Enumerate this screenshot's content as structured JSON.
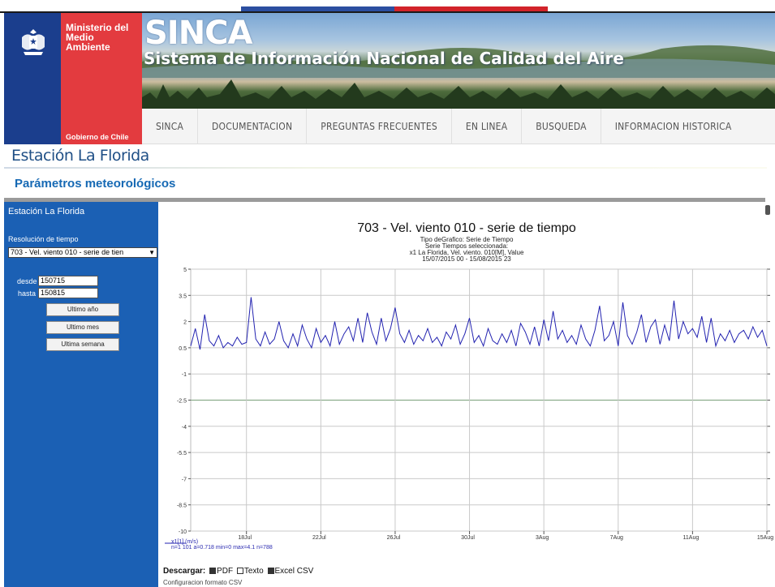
{
  "header": {
    "ministry_name": "Ministerio del Medio Ambiente",
    "gobierno": "Gobierno de Chile",
    "app_name": "SINCA",
    "app_subtitle": "Sistema de Información Nacional de Calidad del Aire",
    "colors": {
      "gov_blue": "#1b3e8d",
      "gov_red": "#e33b3f",
      "link_blue": "#1669b4"
    }
  },
  "nav": {
    "items": [
      {
        "label": "SINCA"
      },
      {
        "label": "DOCUMENTACION"
      },
      {
        "label": "PREGUNTAS FRECUENTES"
      },
      {
        "label": "EN LINEA"
      },
      {
        "label": "BUSQUEDA"
      },
      {
        "label": "INFORMACION HISTORICA"
      }
    ]
  },
  "page": {
    "station_title": "Estación La Florida",
    "section_title": "Parámetros meteorológicos"
  },
  "panel": {
    "title": "Estación La Florida",
    "resolution_label": "Resolución de tiempo",
    "selected_series": "703 - Vel. viento 010 - serie de tien",
    "desde_label": "desde",
    "desde_value": "150715",
    "hasta_label": "hasta",
    "hasta_value": "150815",
    "btn_year": "Ultimo año",
    "btn_month": "Ultimo mes",
    "btn_week": "Ultima semana"
  },
  "chart_data": {
    "type": "line",
    "title": "703 - Vel. viento 010 - serie de tiempo",
    "subtitle_lines": [
      "Tipo deGrafico: Serie de Tiempo",
      "Serie Tiempos seleccionada:",
      "x1 La Florida, Vel. viento. 010[M], Value",
      "15/07/2015 00 - 15/08/2015 23"
    ],
    "y_ticks": [
      5,
      3.5,
      2,
      0.5,
      -1,
      -2.5,
      -4,
      -5.5,
      -7,
      -8.5,
      -10
    ],
    "ylim": [
      -10,
      5
    ],
    "x_ticks": [
      "18Jul",
      "22Jul",
      "26Jul",
      "30Jul",
      "3Aug",
      "7Aug",
      "11Aug",
      "15Aug"
    ],
    "x_tick_days": [
      3,
      7,
      11,
      15,
      19,
      23,
      27,
      31
    ],
    "xlim_days": [
      0,
      31
    ],
    "series": [
      {
        "name": "x1[1] (m/s)",
        "color": "#2222b0",
        "x_days": [
          0,
          0.25,
          0.5,
          0.75,
          1,
          1.25,
          1.5,
          1.75,
          2,
          2.25,
          2.5,
          2.75,
          3,
          3.25,
          3.5,
          3.75,
          4,
          4.25,
          4.5,
          4.75,
          5,
          5.25,
          5.5,
          5.75,
          6,
          6.25,
          6.5,
          6.75,
          7,
          7.25,
          7.5,
          7.75,
          8,
          8.25,
          8.5,
          8.75,
          9,
          9.25,
          9.5,
          9.75,
          10,
          10.25,
          10.5,
          10.75,
          11,
          11.25,
          11.5,
          11.75,
          12,
          12.25,
          12.5,
          12.75,
          13,
          13.25,
          13.5,
          13.75,
          14,
          14.25,
          14.5,
          14.75,
          15,
          15.25,
          15.5,
          15.75,
          16,
          16.25,
          16.5,
          16.75,
          17,
          17.25,
          17.5,
          17.75,
          18,
          18.25,
          18.5,
          18.75,
          19,
          19.25,
          19.5,
          19.75,
          20,
          20.25,
          20.5,
          20.75,
          21,
          21.25,
          21.5,
          21.75,
          22,
          22.25,
          22.5,
          22.75,
          23,
          23.25,
          23.5,
          23.75,
          24,
          24.25,
          24.5,
          24.75,
          25,
          25.25,
          25.5,
          25.75,
          26,
          26.25,
          26.5,
          26.75,
          27,
          27.25,
          27.5,
          27.75,
          28,
          28.25,
          28.5,
          28.75,
          29,
          29.25,
          29.5,
          29.75,
          30,
          30.25,
          30.5,
          30.75,
          31
        ],
        "values": [
          0.6,
          1.6,
          0.4,
          2.4,
          0.9,
          0.6,
          1.2,
          0.5,
          0.8,
          0.6,
          1.1,
          0.7,
          0.8,
          3.4,
          1.0,
          0.6,
          1.4,
          0.7,
          1.0,
          2.0,
          0.9,
          0.5,
          1.3,
          0.6,
          1.8,
          1.0,
          0.5,
          1.6,
          0.8,
          1.2,
          0.6,
          2.0,
          0.7,
          1.3,
          1.7,
          0.9,
          2.2,
          0.8,
          2.5,
          1.4,
          0.7,
          2.2,
          0.9,
          1.6,
          2.8,
          1.3,
          0.8,
          1.5,
          0.7,
          1.2,
          0.9,
          1.6,
          0.8,
          1.1,
          0.6,
          1.4,
          1.0,
          1.8,
          0.7,
          1.3,
          2.2,
          0.8,
          1.2,
          0.6,
          1.6,
          0.9,
          0.7,
          1.3,
          0.8,
          1.5,
          0.6,
          1.9,
          1.4,
          0.7,
          1.7,
          0.6,
          2.1,
          0.9,
          2.6,
          1.0,
          1.5,
          0.8,
          1.2,
          0.7,
          1.8,
          1.0,
          0.6,
          1.5,
          2.9,
          0.9,
          1.2,
          2.0,
          0.6,
          3.1,
          1.2,
          0.7,
          1.4,
          2.4,
          0.8,
          1.7,
          2.1,
          0.7,
          1.8,
          0.9,
          3.2,
          1.0,
          2.0,
          1.3,
          1.6,
          1.1,
          2.3,
          0.8,
          2.2,
          0.6,
          1.3,
          0.9,
          1.5,
          0.8,
          1.3,
          1.5,
          1.0,
          1.7,
          1.1,
          1.5,
          0.6,
          1.4,
          2.0
        ]
      }
    ],
    "legend_lines": [
      "x1[1] (m/s)",
      "n=1 101 a=0.718 min=0 max=4.1 n=788"
    ],
    "grid": true
  },
  "footer": {
    "download_label": "Descargar:",
    "pdf_label": "PDF",
    "texto_label": "Texto",
    "excel_label": "Excel CSV",
    "config_label": "Configuracion formato CSV"
  }
}
